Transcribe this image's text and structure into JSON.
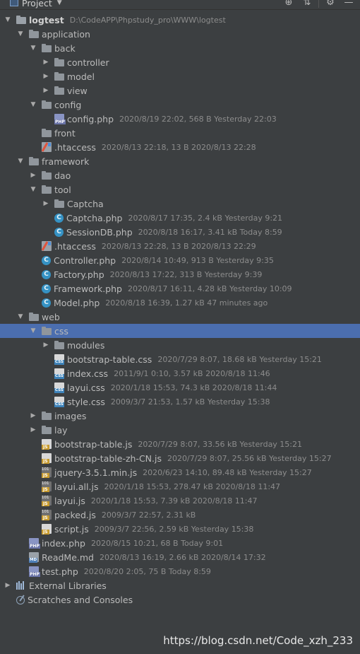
{
  "toolbar": {
    "title": "Project",
    "dropdown_arrow": "▼",
    "buttons": [
      {
        "name": "locate-icon",
        "glyph": "⊕"
      },
      {
        "name": "collapse-all-icon",
        "glyph": "⇅"
      },
      {
        "name": "settings-icon",
        "glyph": "⚙"
      },
      {
        "name": "hide-icon",
        "glyph": "—"
      }
    ]
  },
  "tree": [
    {
      "depth": 0,
      "arrow": "down",
      "icon": "folder-root",
      "name": "logtest",
      "bold": true,
      "meta": "D:\\CodeAPP\\Phpstudy_pro\\WWW\\logtest"
    },
    {
      "depth": 1,
      "arrow": "down",
      "icon": "folder",
      "name": "application"
    },
    {
      "depth": 2,
      "arrow": "down",
      "icon": "folder",
      "name": "back"
    },
    {
      "depth": 3,
      "arrow": "right",
      "icon": "folder",
      "name": "controller"
    },
    {
      "depth": 3,
      "arrow": "right",
      "icon": "folder",
      "name": "model"
    },
    {
      "depth": 3,
      "arrow": "right",
      "icon": "folder",
      "name": "view"
    },
    {
      "depth": 2,
      "arrow": "down",
      "icon": "folder",
      "name": "config"
    },
    {
      "depth": 3,
      "arrow": "none",
      "icon": "php",
      "name": "config.php",
      "meta": "2020/8/19 22:02, 568 B Yesterday 22:03"
    },
    {
      "depth": 2,
      "arrow": "none",
      "icon": "folder",
      "name": "front"
    },
    {
      "depth": 2,
      "arrow": "none",
      "icon": "htaccess",
      "name": ".htaccess",
      "meta": "2020/8/13 22:18, 13 B 2020/8/13 22:28"
    },
    {
      "depth": 1,
      "arrow": "down",
      "icon": "folder",
      "name": "framework"
    },
    {
      "depth": 2,
      "arrow": "right",
      "icon": "folder",
      "name": "dao"
    },
    {
      "depth": 2,
      "arrow": "down",
      "icon": "folder",
      "name": "tool"
    },
    {
      "depth": 3,
      "arrow": "right",
      "icon": "folder",
      "name": "Captcha"
    },
    {
      "depth": 3,
      "arrow": "none",
      "icon": "class",
      "name": "Captcha.php",
      "meta": "2020/8/17 17:35, 2.4 kB Yesterday 9:21"
    },
    {
      "depth": 3,
      "arrow": "none",
      "icon": "class",
      "name": "SessionDB.php",
      "meta": "2020/8/18 16:17, 3.41 kB Today 8:59"
    },
    {
      "depth": 2,
      "arrow": "none",
      "icon": "htaccess",
      "name": ".htaccess",
      "meta": "2020/8/13 22:28, 13 B 2020/8/13 22:29"
    },
    {
      "depth": 2,
      "arrow": "none",
      "icon": "class",
      "name": "Controller.php",
      "meta": "2020/8/14 10:49, 913 B Yesterday 9:35"
    },
    {
      "depth": 2,
      "arrow": "none",
      "icon": "class",
      "name": "Factory.php",
      "meta": "2020/8/13 17:22, 313 B Yesterday 9:39"
    },
    {
      "depth": 2,
      "arrow": "none",
      "icon": "class",
      "name": "Framework.php",
      "meta": "2020/8/17 16:11, 4.28 kB Yesterday 10:09"
    },
    {
      "depth": 2,
      "arrow": "none",
      "icon": "class",
      "name": "Model.php",
      "meta": "2020/8/18 16:39, 1.27 kB 47 minutes ago"
    },
    {
      "depth": 1,
      "arrow": "down",
      "icon": "folder",
      "name": "web"
    },
    {
      "depth": 2,
      "arrow": "down",
      "icon": "folder",
      "name": "css",
      "selected": true
    },
    {
      "depth": 3,
      "arrow": "right",
      "icon": "folder",
      "name": "modules"
    },
    {
      "depth": 3,
      "arrow": "none",
      "icon": "css",
      "name": "bootstrap-table.css",
      "meta": "2020/7/29 8:07, 18.68 kB Yesterday 15:21"
    },
    {
      "depth": 3,
      "arrow": "none",
      "icon": "css",
      "name": "index.css",
      "meta": "2011/9/1 0:10, 3.57 kB 2020/8/18 11:46"
    },
    {
      "depth": 3,
      "arrow": "none",
      "icon": "css",
      "name": "layui.css",
      "meta": "2020/1/18 15:53, 74.3 kB 2020/8/18 11:44"
    },
    {
      "depth": 3,
      "arrow": "none",
      "icon": "css",
      "name": "style.css",
      "meta": "2009/3/7 21:53, 1.57 kB Yesterday 15:38"
    },
    {
      "depth": 2,
      "arrow": "right",
      "icon": "folder",
      "name": "images"
    },
    {
      "depth": 2,
      "arrow": "right",
      "icon": "folder",
      "name": "lay"
    },
    {
      "depth": 2,
      "arrow": "none",
      "icon": "js",
      "name": "bootstrap-table.js",
      "meta": "2020/7/29 8:07, 33.56 kB Yesterday 15:21"
    },
    {
      "depth": 2,
      "arrow": "none",
      "icon": "js",
      "name": "bootstrap-table-zh-CN.js",
      "meta": "2020/7/29 8:07, 25.56 kB Yesterday 15:27"
    },
    {
      "depth": 2,
      "arrow": "none",
      "icon": "minjs",
      "name": "jquery-3.5.1.min.js",
      "meta": "2020/6/23 14:10, 89.48 kB Yesterday 15:27"
    },
    {
      "depth": 2,
      "arrow": "none",
      "icon": "minjs",
      "name": "layui.all.js",
      "meta": "2020/1/18 15:53, 278.47 kB 2020/8/18 11:47"
    },
    {
      "depth": 2,
      "arrow": "none",
      "icon": "minjs",
      "name": "layui.js",
      "meta": "2020/1/18 15:53, 7.39 kB 2020/8/18 11:47"
    },
    {
      "depth": 2,
      "arrow": "none",
      "icon": "minjs",
      "name": "packed.js",
      "meta": "2009/3/7 22:57, 2.31 kB"
    },
    {
      "depth": 2,
      "arrow": "none",
      "icon": "js",
      "name": "script.js",
      "meta": "2009/3/7 22:56, 2.59 kB Yesterday 15:38"
    },
    {
      "depth": 1,
      "arrow": "none",
      "icon": "php",
      "name": "index.php",
      "meta": "2020/8/15 10:21, 68 B Today 9:01"
    },
    {
      "depth": 1,
      "arrow": "none",
      "icon": "md",
      "name": "ReadMe.md",
      "meta": "2020/8/13 16:19, 2.66 kB 2020/8/14 17:32"
    },
    {
      "depth": 1,
      "arrow": "none",
      "icon": "php",
      "name": "test.php",
      "meta": "2020/8/20 2:05, 75 B Today 8:59"
    },
    {
      "depth": 0,
      "arrow": "right",
      "icon": "libraries",
      "name": "External Libraries"
    },
    {
      "depth": 0,
      "arrow": "none",
      "icon": "scratches",
      "name": "Scratches and Consoles"
    }
  ],
  "watermark": "https://blog.csdn.net/Code_xzh_233"
}
